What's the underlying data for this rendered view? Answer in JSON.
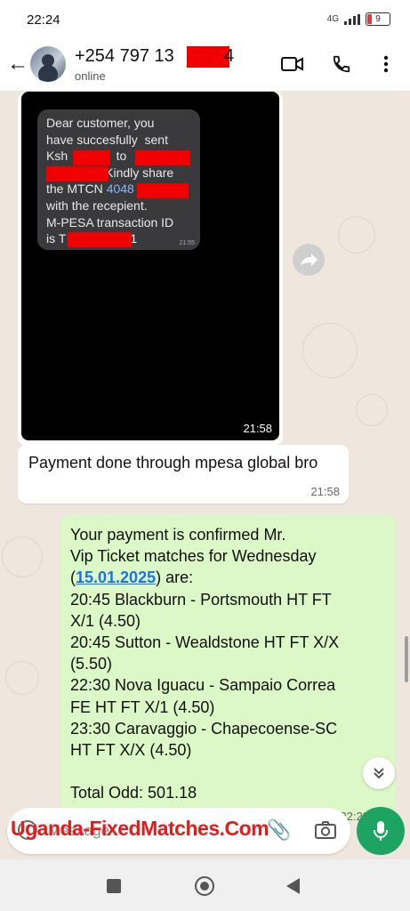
{
  "status_bar": {
    "time": "22:24",
    "network": "4G",
    "battery": "9"
  },
  "header": {
    "back_icon": "arrow-left-icon",
    "contact_name": "+254 797 13",
    "contact_name_suffix": "4",
    "contact_status": "online",
    "actions": [
      "video-call-icon",
      "voice-call-icon",
      "more-vert-icon"
    ]
  },
  "messages": {
    "image_message": {
      "sms_text": "Dear customer, you\nhave succesfully  sent\nKsh              to\n                .Kindly share\nthe MTCN ",
      "sms_link": "4048",
      "sms_text_2": "\nwith the recepient.\nM-PESA transaction ID\nis T",
      "sms_tail": "1",
      "sms_time": "21:55",
      "time": "21:58"
    },
    "incoming": {
      "text": "Payment done through mpesa global bro",
      "time": "21:58"
    },
    "outgoing": {
      "line1": "Your payment is confirmed Mr.",
      "line2": "Vip Ticket matches for Wednesday",
      "date_open": "(",
      "date": "15.01.2025",
      "date_close": ") are:",
      "line4": "20:45 Blackburn - Portsmouth HT FT",
      "line5": "X/1 (4.50)",
      "line6": "20:45 Sutton - Wealdstone HT FT X/X",
      "line7": "(5.50)",
      "line8": "22:30 Nova Iguacu - Sampaio Correa",
      "line9": "FE HT FT X/1 (4.50)",
      "line10": "23:30 Caravaggio - Chapecoense-SC",
      "line11": "HT FT X/X (4.50)",
      "total": "Total Odd: 501.18",
      "time": "22:23",
      "ticks": "✓✓"
    }
  },
  "composer": {
    "placeholder": "Message",
    "watermark": "Uganda-FixedMatches.Com"
  },
  "colors": {
    "accent_green": "#1da462",
    "outgoing_bubble": "#dcf8c6",
    "redaction": "#f20000"
  }
}
